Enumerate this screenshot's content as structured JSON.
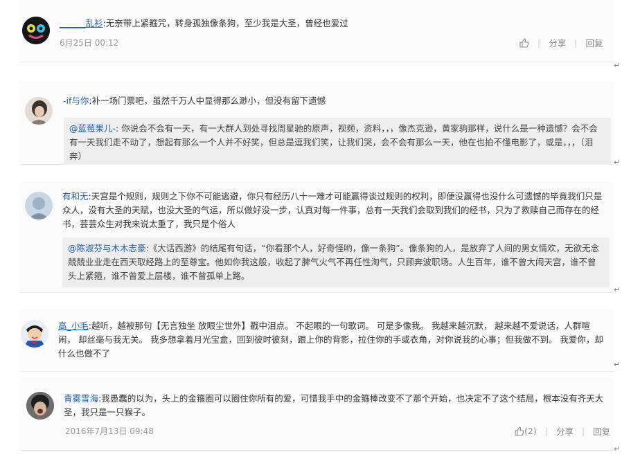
{
  "comments": [
    {
      "name": "______乱衫",
      "sep": ":",
      "text": "无奈带上紧箍咒，转身孤独像条狗，至少我是大圣，曾经也爱过",
      "date": "6月25日 00:12",
      "like": "",
      "share": "分享",
      "reply": "回复"
    },
    {
      "name": "-if与你",
      "sep": ":",
      "text": "补一场门票吧，虽然千万人中显得那么渺小，但没有留下遗憾",
      "quote_name": "@蓝莓果儿-",
      "quote_text": ": 你说会不会有一天，有一大群人到处寻找周星驰的原声，视频，资料，，，像杰克逊，黄家驹那样，说什么是一种遗憾？会不会有一天我们走不动了，想起有那么一个人并不好笑，但总是逗我们笑，让我们哭，会不会有那么一天，他在也拍不懂电影了，或是，，，（泪奔）"
    },
    {
      "name": "有和无",
      "sep": ":",
      "text": "天宫是个规则，规则之下你不可能逃避，你只有经历八十一难才可能赢得谈过规则的权利，即便没赢得也没什么可遗憾的毕竟我们只是众人，没有大圣的天赋，也没大圣的气运，所以做好没一步，认真对每一件事，总有一天我们会取到我们的经书，只为了救赎自己而存在的经书，芸芸众生对我来说太重了，我只是个俗人",
      "quote_name": "@陈淑芬与木木志豪",
      "quote_text": ":《大话西游》的结尾有句话，“你看那个人，好奇怪哟，像一条狗”。像条狗的人，是放弃了人间的男女情欢，无欲无念兢兢业业走在西天取经路上的至尊宝。他如你我这般，收起了脾气火气不再任性淘气，只顾奔波职场。人生百年，谁不曾大闹天宫，谁不曾头上紧箍，谁不曾爱上层楼，谁不曾孤单上路。"
    },
    {
      "name": "高_小毛",
      "sep": ":",
      "text": "越听，越被那句【无言独坐 放眼尘世外】戳中泪点。 不起眼的一句歌词。 可是多像我。 我越来越沉默， 越来越不爱说话，人群喧闹， 却丝毫与我无关。 我多想拿着月光宝盒，回到彼时彼刻，跟上你的背影，拉住你的手或衣角，对你说我的心事；但我做不到。 我爱你，却什么也做不了"
    },
    {
      "name": "青雾雪海",
      "sep": ":",
      "text": "我愚蠢的以为，头上的金箍圈可以圈住你所有的爱，可惜我手中的金箍棒改变不了那个开始，也决定不了这个结局，根本没有齐天大圣，我只是一只猴子。",
      "date": "2016年7月13日 09:48",
      "like": "(2)",
      "share": "分享",
      "reply": "回复"
    }
  ],
  "return_mark": "↵",
  "colors": {
    "link": "#1f5fa6",
    "meta": "#999999",
    "quote_bg": "#eeeeee",
    "card_bg": "#fbfbfb"
  }
}
